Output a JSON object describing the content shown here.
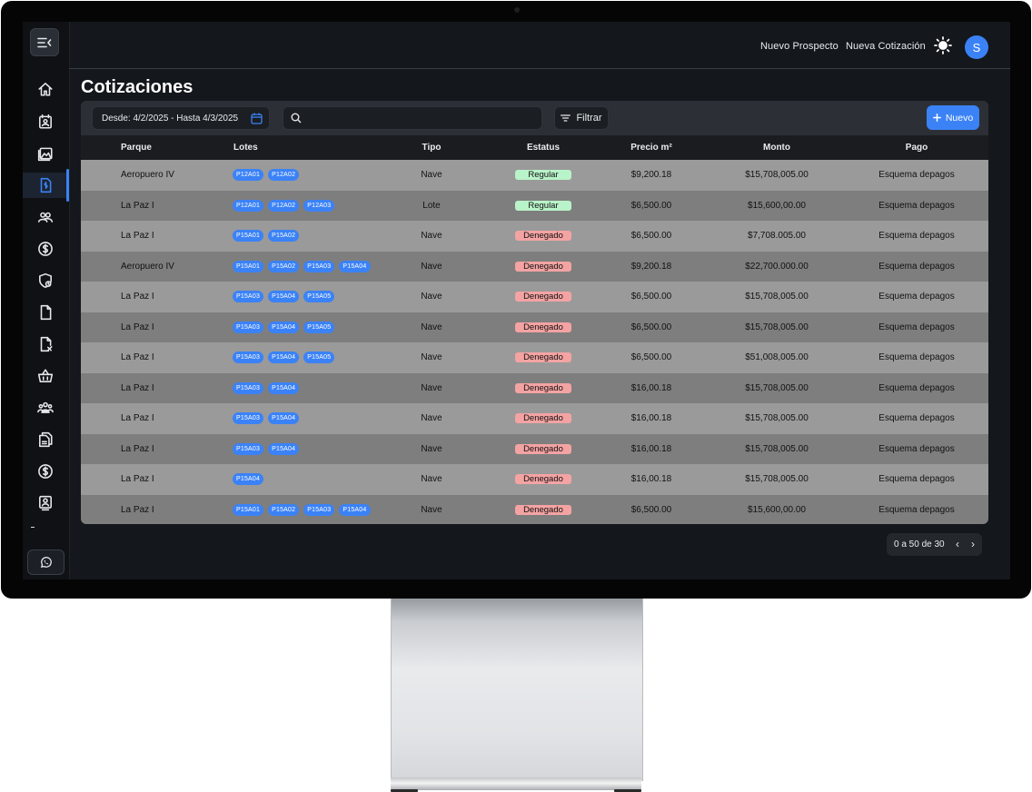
{
  "header": {
    "new_prospect": "Nuevo Prospecto",
    "new_quote": "Nueva Cotización",
    "avatar_initial": "S"
  },
  "page": {
    "title": "Cotizaciones"
  },
  "toolbar": {
    "date_range": "Desde: 4/2/2025 - Hasta 4/3/2025",
    "search_value": "",
    "filter_label": "Filtrar",
    "new_label": "Nuevo"
  },
  "table": {
    "columns": {
      "parque": "Parque",
      "lotes": "Lotes",
      "tipo": "Tipo",
      "estatus": "Estatus",
      "precio": "Precio m²",
      "monto": "Monto",
      "pago": "Pago"
    },
    "rows": [
      {
        "parque": "Aeropuero IV",
        "lotes": [
          "P12A01",
          "P12A02"
        ],
        "tipo": "Nave",
        "estatus": "Regular",
        "precio": "$9,200.18",
        "monto": "$15,708,005.00",
        "pago": "Esquema depagos"
      },
      {
        "parque": "La Paz I",
        "lotes": [
          "P12A01",
          "P12A02",
          "P12A03"
        ],
        "tipo": "Lote",
        "estatus": "Regular",
        "precio": "$6,500.00",
        "monto": "$15,600,00.00",
        "pago": "Esquema depagos"
      },
      {
        "parque": "La Paz I",
        "lotes": [
          "P15A01",
          "P15A02"
        ],
        "tipo": "Nave",
        "estatus": "Denegado",
        "precio": "$6,500.00",
        "monto": "$7,708.005.00",
        "pago": "Esquema depagos"
      },
      {
        "parque": "Aeropuero IV",
        "lotes": [
          "P15A01",
          "P15A02",
          "P15A03",
          "P15A04"
        ],
        "tipo": "Nave",
        "estatus": "Denegado",
        "precio": "$9,200.18",
        "monto": "$22,700.000.00",
        "pago": "Esquema depagos"
      },
      {
        "parque": "La Paz I",
        "lotes": [
          "P15A03",
          "P15A04",
          "P15A05"
        ],
        "tipo": "Nave",
        "estatus": "Denegado",
        "precio": "$6,500.00",
        "monto": "$15,708,005.00",
        "pago": "Esquema depagos"
      },
      {
        "parque": "La Paz I",
        "lotes": [
          "P15A03",
          "P15A04",
          "P15A05"
        ],
        "tipo": "Nave",
        "estatus": "Denegado",
        "precio": "$6,500.00",
        "monto": "$15,708,005.00",
        "pago": "Esquema depagos"
      },
      {
        "parque": "La Paz I",
        "lotes": [
          "P15A03",
          "P15A04",
          "P15A05"
        ],
        "tipo": "Nave",
        "estatus": "Denegado",
        "precio": "$6,500.00",
        "monto": "$51,008,005.00",
        "pago": "Esquema depagos"
      },
      {
        "parque": "La Paz I",
        "lotes": [
          "P15A03",
          "P15A04"
        ],
        "tipo": "Nave",
        "estatus": "Denegado",
        "precio": "$16,00.18",
        "monto": "$15,708,005.00",
        "pago": "Esquema depagos"
      },
      {
        "parque": "La Paz I",
        "lotes": [
          "P15A03",
          "P15A04"
        ],
        "tipo": "Nave",
        "estatus": "Denegado",
        "precio": "$16,00.18",
        "monto": "$15,708,005.00",
        "pago": "Esquema depagos"
      },
      {
        "parque": "La Paz I",
        "lotes": [
          "P15A03",
          "P15A04"
        ],
        "tipo": "Nave",
        "estatus": "Denegado",
        "precio": "$16,00.18",
        "monto": "$15,708,005.00",
        "pago": "Esquema depagos"
      },
      {
        "parque": "La Paz I",
        "lotes": [
          "P15A04"
        ],
        "tipo": "Nave",
        "estatus": "Denegado",
        "precio": "$16,00.18",
        "monto": "$15,708,005.00",
        "pago": "Esquema depagos"
      },
      {
        "parque": "La Paz I",
        "lotes": [
          "P15A01",
          "P15A02",
          "P15A03",
          "P15A04"
        ],
        "tipo": "Nave",
        "estatus": "Denegado",
        "precio": "$6,500.00",
        "monto": "$15,600,00.00",
        "pago": "Esquema depagos"
      }
    ]
  },
  "pagination": {
    "label": "0 a 50 de 30"
  },
  "sidebar": {
    "items": [
      "home-icon",
      "contact-card-icon",
      "gallery-icon",
      "quote-document-icon",
      "users-icon",
      "dollar-icon",
      "shield-icon",
      "file-icon",
      "file-edit-icon",
      "basket-icon",
      "team-icon",
      "documents-icon",
      "dollar-circle-icon",
      "id-badge-icon"
    ],
    "active_index": 3
  },
  "colors": {
    "accent": "#3b82f6",
    "regular": "#b9f3c9",
    "denegado": "#f4a3a3"
  }
}
